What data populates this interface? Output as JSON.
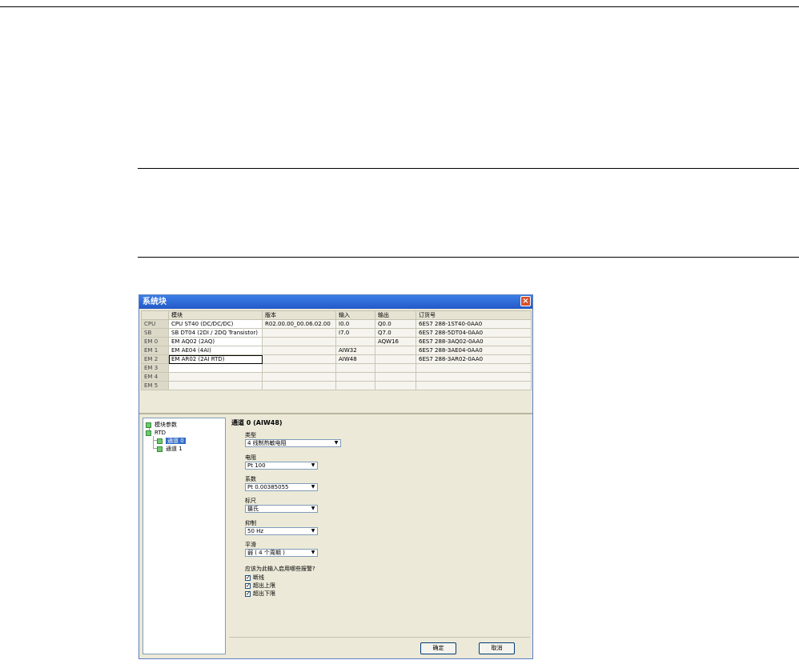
{
  "window": {
    "title": "系统块",
    "close_label": "×"
  },
  "grid": {
    "headers": [
      "",
      "模块",
      "版本",
      "输入",
      "输出",
      "订货号"
    ],
    "rows": [
      {
        "slot": "CPU",
        "module": "CPU ST40 (DC/DC/DC)",
        "version": "R02.00.00_00.06.02.00",
        "input": "I0.0",
        "output": "Q0.0",
        "order": "6ES7 288-1ST40-0AA0"
      },
      {
        "slot": "SB",
        "module": "SB DT04 (2DI / 2DQ Transistor)",
        "version": "",
        "input": "I7.0",
        "output": "Q7.0",
        "order": "6ES7 288-5DT04-0AA0"
      },
      {
        "slot": "EM 0",
        "module": "EM AQ02 (2AQ)",
        "version": "",
        "input": "",
        "output": "AQW16",
        "order": "6ES7 288-3AQ02-0AA0"
      },
      {
        "slot": "EM 1",
        "module": "EM AE04 (4AI)",
        "version": "",
        "input": "AIW32",
        "output": "",
        "order": "6ES7 288-3AE04-0AA0"
      },
      {
        "slot": "EM 2",
        "module": "EM AR02 (2AI RTD)",
        "version": "",
        "input": "AIW48",
        "output": "",
        "order": "6ES7 288-3AR02-0AA0"
      },
      {
        "slot": "EM 3",
        "module": "",
        "version": "",
        "input": "",
        "output": "",
        "order": ""
      },
      {
        "slot": "EM 4",
        "module": "",
        "version": "",
        "input": "",
        "output": "",
        "order": ""
      },
      {
        "slot": "EM 5",
        "module": "",
        "version": "",
        "input": "",
        "output": "",
        "order": ""
      }
    ]
  },
  "tree": {
    "module_params": "模块参数",
    "rtd": "RTD",
    "channel0": "通道 0",
    "channel1": "通道 1"
  },
  "panel": {
    "title": "通道 0 (AIW48)",
    "type_label": "类型",
    "type_value": "4 线制热敏电阻",
    "resistor_label": "电阻",
    "resistor_value": "Pt 100",
    "coef_label": "系数",
    "coef_value": "Pt 0.00385055",
    "scale_label": "标尺",
    "scale_value": "摄氏",
    "reject_label": "抑制",
    "reject_value": "50 Hz",
    "smooth_label": "平滑",
    "smooth_value": "弱 ( 4 个周期 )",
    "alarm_question": "应该为此输入启用哪些报警?",
    "alarm1": "断线",
    "alarm2": "超出上限",
    "alarm3": "超出下限",
    "ok": "确定",
    "cancel": "取消"
  }
}
